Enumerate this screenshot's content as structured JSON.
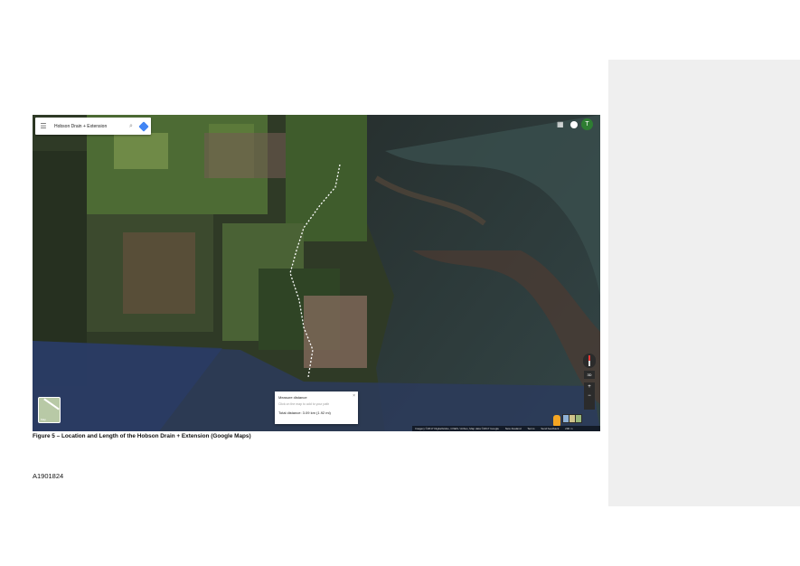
{
  "search": {
    "query": "Hobson Drain + Extension"
  },
  "header": {
    "avatar_letter": "T"
  },
  "map_controls": {
    "btn_3d": "3D",
    "zoom_in": "+",
    "zoom_out": "−"
  },
  "layers_thumb": {
    "label": "Map"
  },
  "measure": {
    "title": "Measure distance",
    "hint": "Click on the map to add to your path",
    "total": "Total distance: 3.09 km (1.92 mi)",
    "close": "×"
  },
  "attribution": [
    "Imagery ©2017 DigitalGlobe, CNES / Airbus, Map data ©2017 Google",
    "New Zealand",
    "Terms",
    "Send feedback",
    "200 m"
  ],
  "caption": "Figure 5 – Location and Length of the Hobson Drain + Extension (Google Maps)",
  "doc_id": "A1901824",
  "icons": [
    "menu-icon",
    "search-icon",
    "directions-icon",
    "apps-icon",
    "notifications-icon",
    "compass-icon",
    "pegman-icon",
    "layers-icon"
  ],
  "colors": {
    "route": "#ffffff",
    "directions": "#4285f4",
    "avatar": "#2e7d32"
  }
}
